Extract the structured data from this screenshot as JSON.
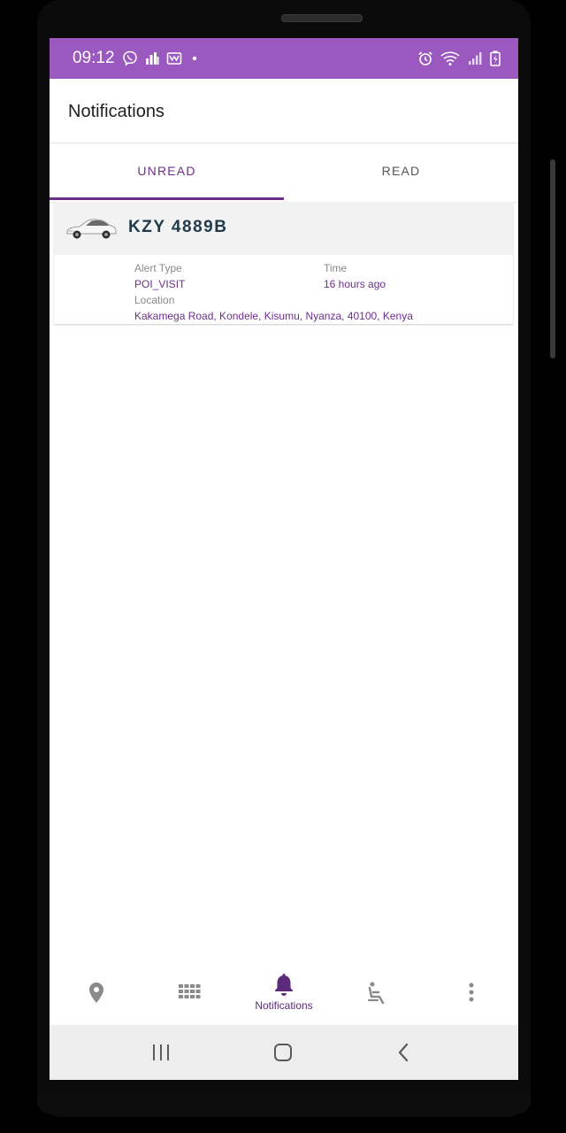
{
  "status_bar": {
    "time": "09:12",
    "left_icons": [
      "viber-icon",
      "chart-icon",
      "mail-icon",
      "dot-icon"
    ],
    "right_icons": [
      "alarm-icon",
      "wifi-icon",
      "signal-icon",
      "battery-icon"
    ]
  },
  "app_bar": {
    "title": "Notifications"
  },
  "tabs": [
    {
      "label": "UNREAD",
      "active": true
    },
    {
      "label": "READ",
      "active": false
    }
  ],
  "notifications": [
    {
      "plate": "KZY 4889B",
      "alert_type_label": "Alert Type",
      "alert_type": "POI_VISIT",
      "time_label": "Time",
      "time": "16 hours ago",
      "location_label": "Location",
      "location": "Kakamega Road, Kondele, Kisumu, Nyanza, 40100, Kenya"
    }
  ],
  "bottom_nav": {
    "items": [
      {
        "icon": "location-pin-icon",
        "label": ""
      },
      {
        "icon": "grid-icon",
        "label": ""
      },
      {
        "icon": "bell-icon",
        "label": "Notifications",
        "active": true
      },
      {
        "icon": "seat-icon",
        "label": ""
      },
      {
        "icon": "more-vert-icon",
        "label": ""
      }
    ]
  },
  "colors": {
    "status_bar": "#9b59bf",
    "accent": "#6d2f8c",
    "plate_text": "#1f3a4a",
    "card_header": "#f2f2f2"
  }
}
